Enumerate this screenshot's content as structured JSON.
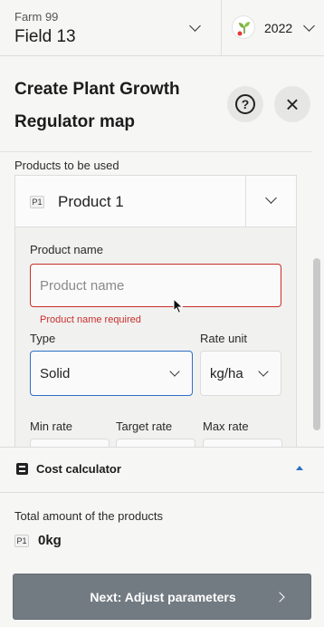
{
  "header": {
    "farm_name": "Farm 99",
    "field_name": "Field 13",
    "season_year": "2022"
  },
  "panel": {
    "title": "Create Plant Growth Regulator map",
    "products_label": "Products to be used",
    "selected_product": {
      "badge": "P1",
      "name": "Product 1"
    },
    "form": {
      "product_name_label": "Product name",
      "product_name_value": "",
      "product_name_placeholder": "Product name",
      "product_name_error": "Product name required",
      "type_label": "Type",
      "type_value": "Solid",
      "rate_unit_label": "Rate unit",
      "rate_unit_value": "kg/ha",
      "min_rate_label": "Min rate",
      "target_rate_label": "Target rate",
      "max_rate_label": "Max rate"
    }
  },
  "cost_calculator": {
    "title": "Cost calculator",
    "total_label": "Total amount of the products",
    "total_badge": "P1",
    "total_value": "0kg"
  },
  "footer": {
    "next_label": "Next: Adjust parameters"
  },
  "colors": {
    "error": "#c8302c",
    "focus": "#2f6fc8",
    "primary_button": "#737b82"
  },
  "icons": {
    "season": "sprout-icon",
    "help": "question-circle-icon",
    "close": "close-icon",
    "calculator": "calculator-icon",
    "collapse": "chevron-up-icon"
  }
}
